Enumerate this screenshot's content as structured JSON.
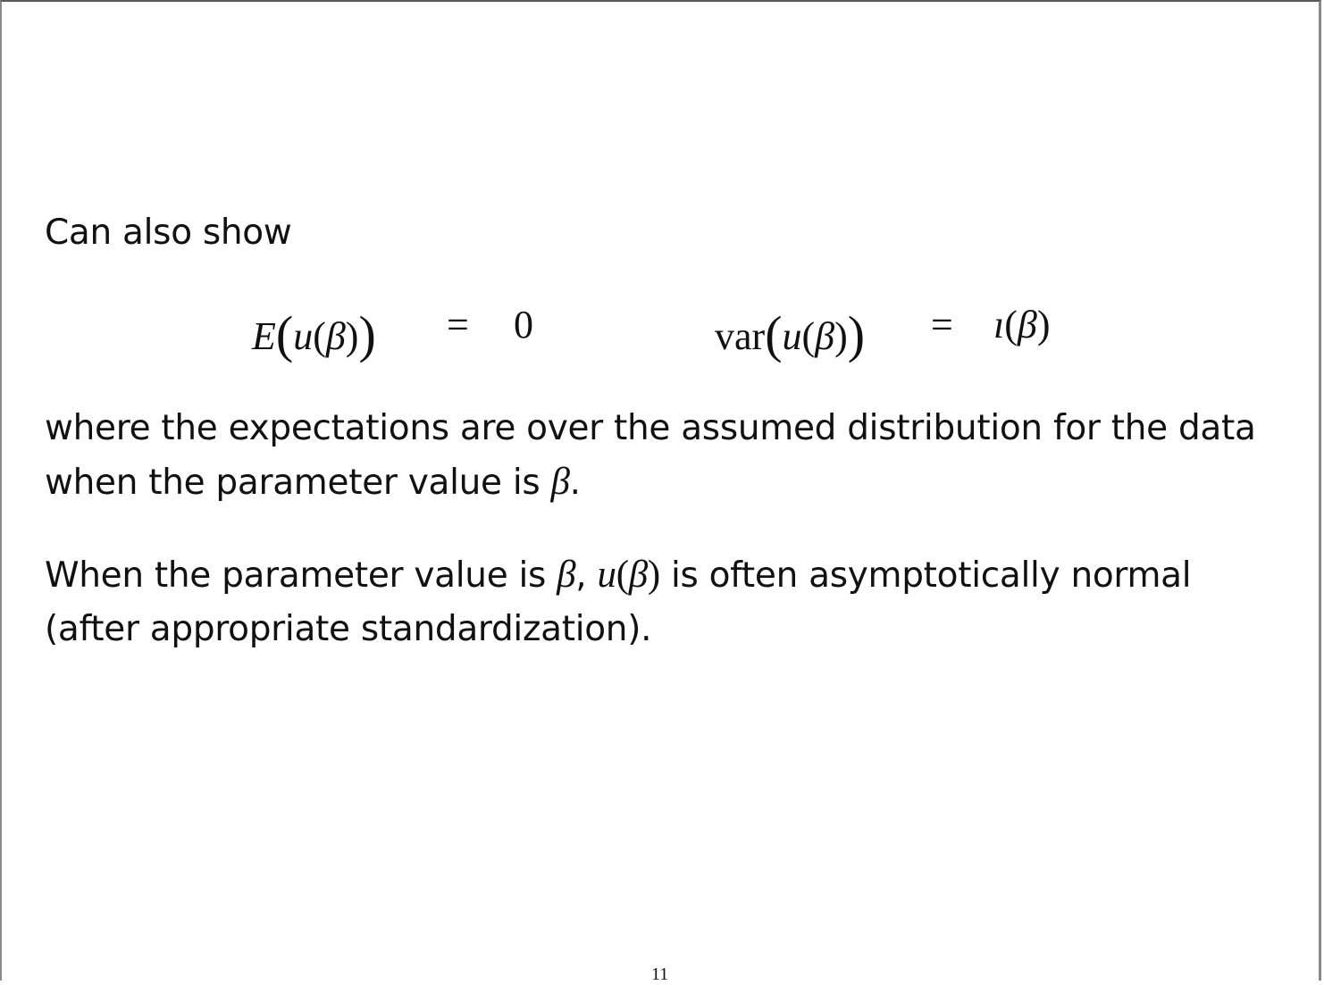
{
  "slide": {
    "intro": "Can also show",
    "equations": {
      "left": {
        "func": "E",
        "arg_var": "u",
        "param": "β",
        "equals": "=",
        "rhs": "0"
      },
      "right": {
        "func": "var",
        "arg_var": "u",
        "param": "β",
        "equals": "=",
        "rhs_var": "ı",
        "rhs_param": "β"
      }
    },
    "para1": {
      "line1": "where the expectations are over the assumed distribution for the data",
      "line2_text": "when the parameter value is ",
      "line2_math": "β",
      "line2_end": "."
    },
    "para2": {
      "line1_text": "When the parameter value is ",
      "line1_math": "β",
      "line1_sep": ", ",
      "line1_u": "u",
      "line1_paren_open": "(",
      "line1_beta": "β",
      "line1_paren_close": ")",
      "line1_rest": " is often asymptotically normal",
      "line2": "(after appropriate standardization)."
    },
    "page_number": "11"
  }
}
